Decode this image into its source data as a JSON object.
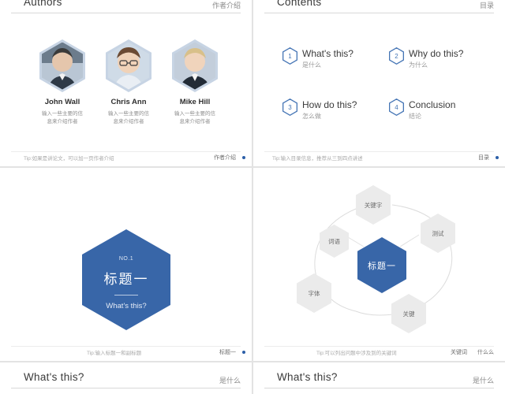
{
  "deck": {
    "slides": [
      {
        "id": "authors",
        "title": "Authors",
        "title_cn": "作者介绍",
        "footer_tip": "Tip:如果是讲论文，可以加一页作者介绍",
        "footer_label": "作者介绍",
        "authors": [
          {
            "name": "John Wall",
            "desc": "输入一些主要的信息来介绍作者"
          },
          {
            "name": "Chris Ann",
            "desc": "输入一些主要的信息来介绍作者"
          },
          {
            "name": "Mike Hill",
            "desc": "输入一些主要的信息来介绍作者"
          }
        ]
      },
      {
        "id": "contents",
        "title": "Contents",
        "title_cn": "目录",
        "footer_tip": "Tip:输入目录信息，推荐从三到四点讲述",
        "footer_label": "目录",
        "items": [
          {
            "num": "1",
            "en": "What's this?",
            "cn": "是什么"
          },
          {
            "num": "2",
            "en": "Why do this?",
            "cn": "为什么"
          },
          {
            "num": "3",
            "en": "How do this?",
            "cn": "怎么做"
          },
          {
            "num": "4",
            "en": "Conclusion",
            "cn": "结论"
          }
        ]
      },
      {
        "id": "section-title",
        "no_label": "NO.1",
        "cn_title": "标题一",
        "en_title": "What's this?",
        "footer_tip": "Tip:输入标题一和副标题",
        "footer_label": "标题一"
      },
      {
        "id": "hex-diagram",
        "center": "标题一",
        "nodes": [
          "关键字",
          "测试",
          "词语",
          "字体",
          "关键"
        ],
        "footer_tip": "Tip:可以列出问题中涉及到的关键词",
        "footer_label": "关键词",
        "footer_label2": "什么么"
      },
      {
        "id": "whats-this-a",
        "title": "What's this?",
        "title_cn": "是什么"
      },
      {
        "id": "whats-this-b",
        "title": "What's this?",
        "title_cn": "是什么"
      }
    ]
  },
  "colors": {
    "accent": "#3866a8",
    "accent_light": "#4575b5",
    "hex_gray": "#ebebeb",
    "text_dark": "#3a3a3a",
    "text_muted": "#9a9a9a"
  }
}
